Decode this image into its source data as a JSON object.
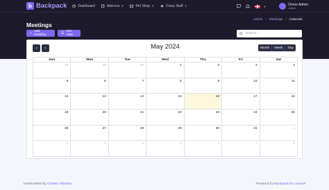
{
  "app": {
    "name": "Backpack"
  },
  "nav": {
    "items": [
      {
        "label": "Dashboard",
        "icon": "dashboard-icon"
      },
      {
        "label": "Add-ons",
        "icon": "puzzle-icon",
        "dropdown": true
      },
      {
        "label": "Pet Shop",
        "icon": "cat-icon",
        "dropdown": true
      },
      {
        "label": "Crazy Stuff",
        "icon": "star-icon",
        "dropdown": true
      }
    ],
    "user": {
      "name": "Demo Admin",
      "role": "Admin"
    }
  },
  "breadcrumb": {
    "items": [
      "Admin",
      "Meetings",
      "Calendar"
    ]
  },
  "page": {
    "title": "Meetings"
  },
  "toolbar": {
    "add_label": "Add meeting",
    "list_label": "List view"
  },
  "search": {
    "placeholder": "Search..."
  },
  "calendar": {
    "month_label": "May 2024",
    "views": [
      "Month",
      "Week",
      "Day"
    ],
    "weekdays": [
      "Sun",
      "Mon",
      "Tue",
      "Wed",
      "Thu",
      "Fri",
      "Sat"
    ],
    "weeks": [
      [
        {
          "day": "28",
          "other": true
        },
        {
          "day": "29",
          "other": true
        },
        {
          "day": "30",
          "other": true
        },
        {
          "day": "1"
        },
        {
          "day": "2"
        },
        {
          "day": "3"
        },
        {
          "day": "4"
        }
      ],
      [
        {
          "day": "5"
        },
        {
          "day": "6"
        },
        {
          "day": "7"
        },
        {
          "day": "8"
        },
        {
          "day": "9"
        },
        {
          "day": "10"
        },
        {
          "day": "11"
        }
      ],
      [
        {
          "day": "12"
        },
        {
          "day": "13"
        },
        {
          "day": "14"
        },
        {
          "day": "15"
        },
        {
          "day": "16",
          "today": true
        },
        {
          "day": "17"
        },
        {
          "day": "18"
        }
      ],
      [
        {
          "day": "19"
        },
        {
          "day": "20"
        },
        {
          "day": "21"
        },
        {
          "day": "22"
        },
        {
          "day": "23"
        },
        {
          "day": "24"
        },
        {
          "day": "25"
        }
      ],
      [
        {
          "day": "26"
        },
        {
          "day": "27"
        },
        {
          "day": "28"
        },
        {
          "day": "29"
        },
        {
          "day": "30"
        },
        {
          "day": "31"
        },
        {
          "day": "1",
          "other": true
        }
      ],
      [
        {
          "day": "2",
          "other": true
        },
        {
          "day": "3",
          "other": true
        },
        {
          "day": "4",
          "other": true
        },
        {
          "day": "5",
          "other": true
        },
        {
          "day": "6",
          "other": true
        },
        {
          "day": "7",
          "other": true
        },
        {
          "day": "8",
          "other": true
        }
      ]
    ]
  },
  "footer": {
    "left_prefix": "Handcrafted by",
    "left_link": "Cristian Tabacitu",
    "right_prefix": "Powered by",
    "right_link": "Backpack for Laravel"
  },
  "colors": {
    "accent": "#7c69ef",
    "header_bg": "#1c1a2b",
    "today_bg": "#fdf7dc"
  }
}
